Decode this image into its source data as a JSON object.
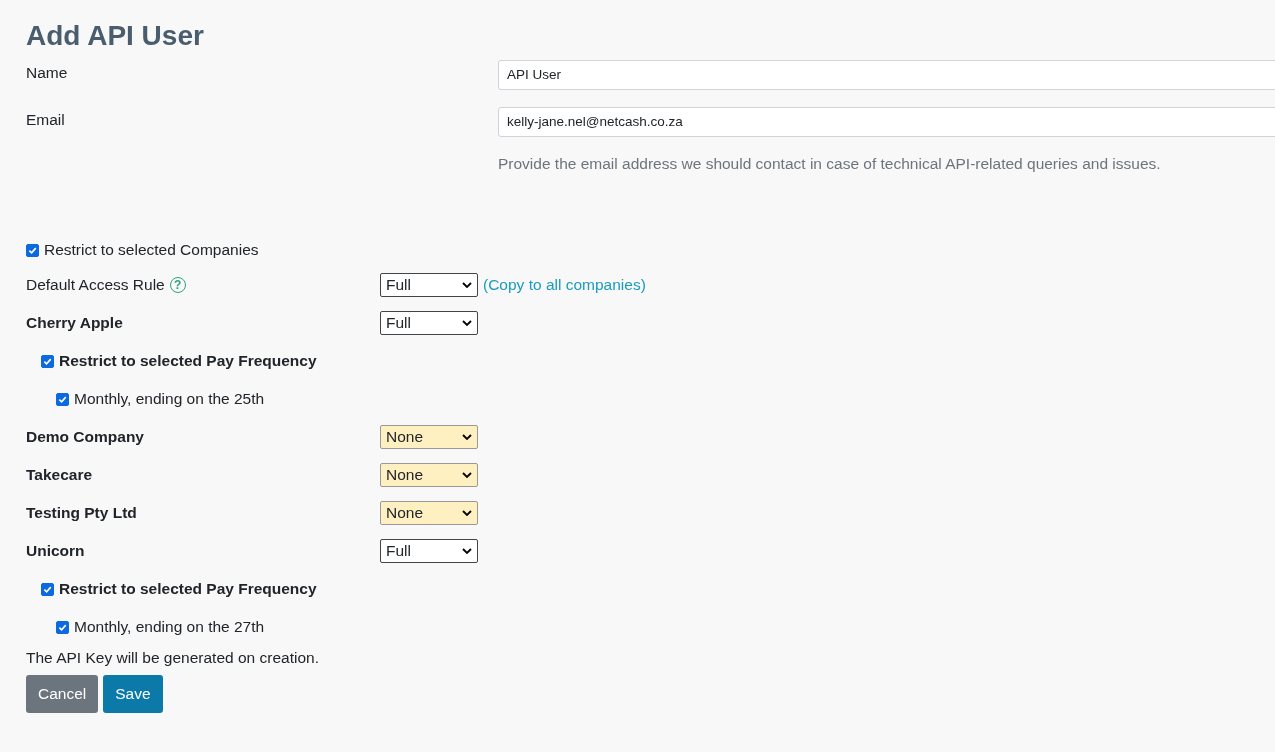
{
  "title": "Add API User",
  "fields": [
    {
      "label": "Name",
      "value": "API User"
    },
    {
      "label": "Email",
      "value": "kelly-jane.nel@netcash.co.za",
      "help": "Provide the email address we should contact in case of technical API-related queries and issues."
    }
  ],
  "restrict_companies": {
    "label": "Restrict to selected Companies",
    "checked": true
  },
  "default_rule": {
    "label": "Default Access Rule",
    "value": "Full",
    "help_icon": "?",
    "link": "(Copy to all companies)"
  },
  "companies": [
    {
      "name": "Cherry Apple",
      "access": "Full",
      "warning": false,
      "pay_frequency": {
        "label": "Restrict to selected Pay Frequency",
        "checked": true,
        "options": [
          {
            "label": "Monthly, ending on the 25th",
            "checked": true
          }
        ]
      }
    },
    {
      "name": "Demo Company",
      "access": "None",
      "warning": true
    },
    {
      "name": "Takecare",
      "access": "None",
      "warning": true
    },
    {
      "name": "Testing Pty Ltd",
      "access": "None",
      "warning": true
    },
    {
      "name": "Unicorn",
      "access": "Full",
      "warning": false,
      "pay_frequency": {
        "label": "Restrict to selected Pay Frequency",
        "checked": true,
        "options": [
          {
            "label": "Monthly, ending on the 27th",
            "checked": true
          }
        ]
      }
    }
  ],
  "note": "The API Key will be generated on creation.",
  "buttons": [
    {
      "label": "Cancel",
      "kind": "secondary"
    },
    {
      "label": "Save",
      "kind": "primary"
    }
  ]
}
